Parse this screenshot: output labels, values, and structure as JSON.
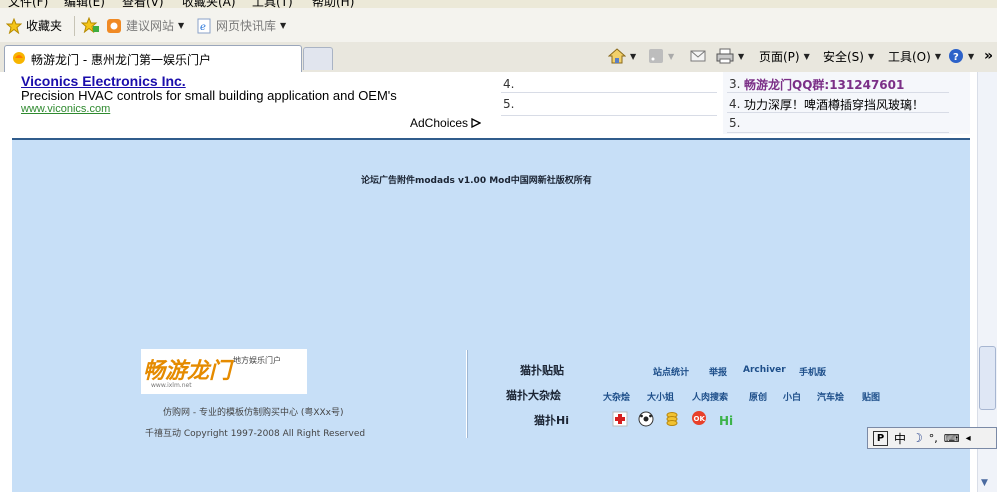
{
  "menu": [
    "文件(F)",
    "编辑(E)",
    "查看(V)",
    "收藏夹(A)",
    "工具(T)",
    "帮助(H)"
  ],
  "favorites_bar": {
    "favorites_label": "收藏夹",
    "suggested_sites": "建议网站",
    "web_slice_gallery": "网页快讯库"
  },
  "tab": {
    "title": "畅游龙门 - 惠州龙门第一娱乐门户"
  },
  "toolbar": {
    "page_label": "页面(P)",
    "safety_label": "安全(S)",
    "tools_label": "工具(O)"
  },
  "ad": {
    "title": "Viconics Electronics Inc.",
    "description": "Precision HVAC controls for small building application and OEM's",
    "url": "www.viconics.com",
    "adchoices": "AdChoices"
  },
  "middle_list": [
    {
      "num": "4.",
      "text": ""
    },
    {
      "num": "5.",
      "text": ""
    }
  ],
  "right_list": [
    {
      "num": "3.",
      "text": "畅游龙门QQ群:131247601"
    },
    {
      "num": "4.",
      "text": "功力深厚！啤酒樽插穿挡风玻璃！"
    },
    {
      "num": "5.",
      "text": ""
    }
  ],
  "copyright_plugin": "论坛广告附件modads v1.00 Mod中国网新社版权所有",
  "footer": {
    "logo_text": "畅游龙门",
    "logo_slogan": "地方娱乐门户",
    "logo_url": "www.ixlm.net",
    "tagline": "仿购网 - 专业的模板仿制购买中心  (粤XXx号)",
    "copyright": "千禧互动   Copyright 1997-2008 All Right Reserved",
    "sections": [
      {
        "label": "猫扑贴贴",
        "links": [
          "站点统计",
          "举报",
          "Archiver",
          "手机版"
        ]
      },
      {
        "label": "猫扑大杂烩",
        "links": [
          "大杂烩",
          "大小姐",
          "人肉搜索",
          "原创",
          "小白",
          "汽车烩",
          "贴图"
        ]
      },
      {
        "label": "猫扑Hi",
        "links": [
          "Hi"
        ]
      }
    ]
  },
  "ime": {
    "mode": "中"
  },
  "colors": {
    "accent": "#305c8c",
    "panel": "#c7dff7",
    "link": "#1a0dab",
    "qq": "#7b2f87"
  }
}
